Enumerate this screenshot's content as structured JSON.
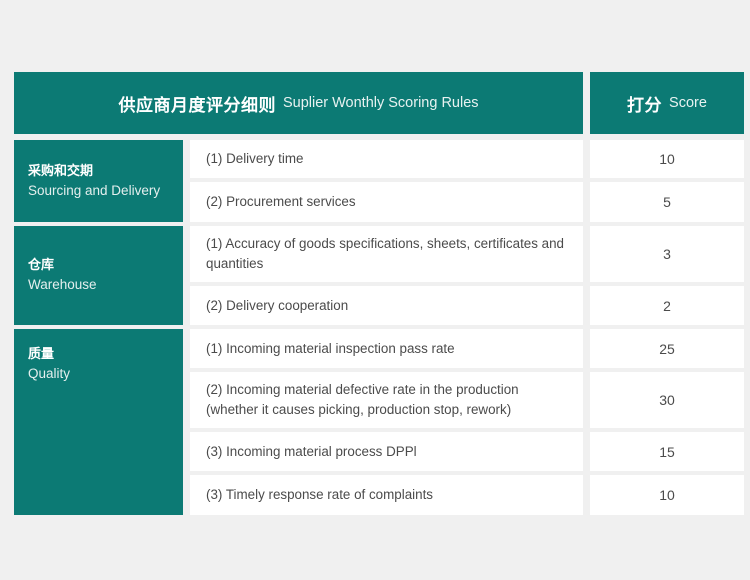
{
  "table": {
    "header": {
      "main_cn": "供应商月度评分细则",
      "main_en": "Suplier Wonthly Scoring Rules",
      "score_cn": "打分",
      "score_en": "Score"
    },
    "colors": {
      "accent_teal": "#0c7a74",
      "page_background": "#f0f0f0",
      "cell_background": "#ffffff",
      "body_text": "#4b4b4b",
      "header_text": "#ffffff"
    },
    "categories": [
      {
        "label_cn": "采购和交期",
        "label_en": "Sourcing and Delivery",
        "rows": [
          {
            "item": "(1) Delivery time",
            "score": "10"
          },
          {
            "item": "(2) Procurement services",
            "score": "5"
          }
        ]
      },
      {
        "label_cn": "仓库",
        "label_en": "Warehouse",
        "rows": [
          {
            "item": "(1) Accuracy of goods specifications, sheets, certificates and quantities",
            "score": "3"
          },
          {
            "item": "(2) Delivery cooperation",
            "score": "2"
          }
        ]
      },
      {
        "label_cn": "质量",
        "label_en": "Quality",
        "rows": [
          {
            "item": "(1) Incoming material inspection pass rate",
            "score": "25"
          },
          {
            "item": "(2) Incoming material defective rate in the production (whether it causes picking, production stop, rework)",
            "score": "30"
          },
          {
            "item": "(3) Incoming material process DPPl",
            "score": "15"
          },
          {
            "item": "(3) Timely response rate of complaints",
            "score": "10"
          }
        ]
      }
    ]
  }
}
